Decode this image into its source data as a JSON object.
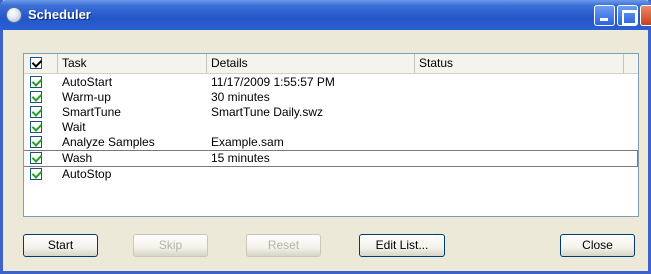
{
  "window": {
    "title": "Scheduler"
  },
  "list": {
    "header_checked": true,
    "columns": [
      "Task",
      "Details",
      "Status"
    ],
    "rows": [
      {
        "task": "AutoStart",
        "details": "11/17/2009 1:55:57 PM",
        "status": "",
        "checked": true
      },
      {
        "task": "Warm-up",
        "details": "30 minutes",
        "status": "",
        "checked": true
      },
      {
        "task": "SmartTune",
        "details": "SmartTune Daily.swz",
        "status": "",
        "checked": true
      },
      {
        "task": "Wait",
        "details": "",
        "status": "",
        "checked": true
      },
      {
        "task": "Analyze Samples",
        "details": "Example.sam",
        "status": "",
        "checked": true
      },
      {
        "task": "Wash",
        "details": "15 minutes",
        "status": "",
        "checked": true
      },
      {
        "task": "AutoStop",
        "details": "",
        "status": "",
        "checked": true
      }
    ]
  },
  "buttons": {
    "start": "Start",
    "skip": "Skip",
    "reset": "Reset",
    "edit_list": "Edit List...",
    "close": "Close"
  }
}
